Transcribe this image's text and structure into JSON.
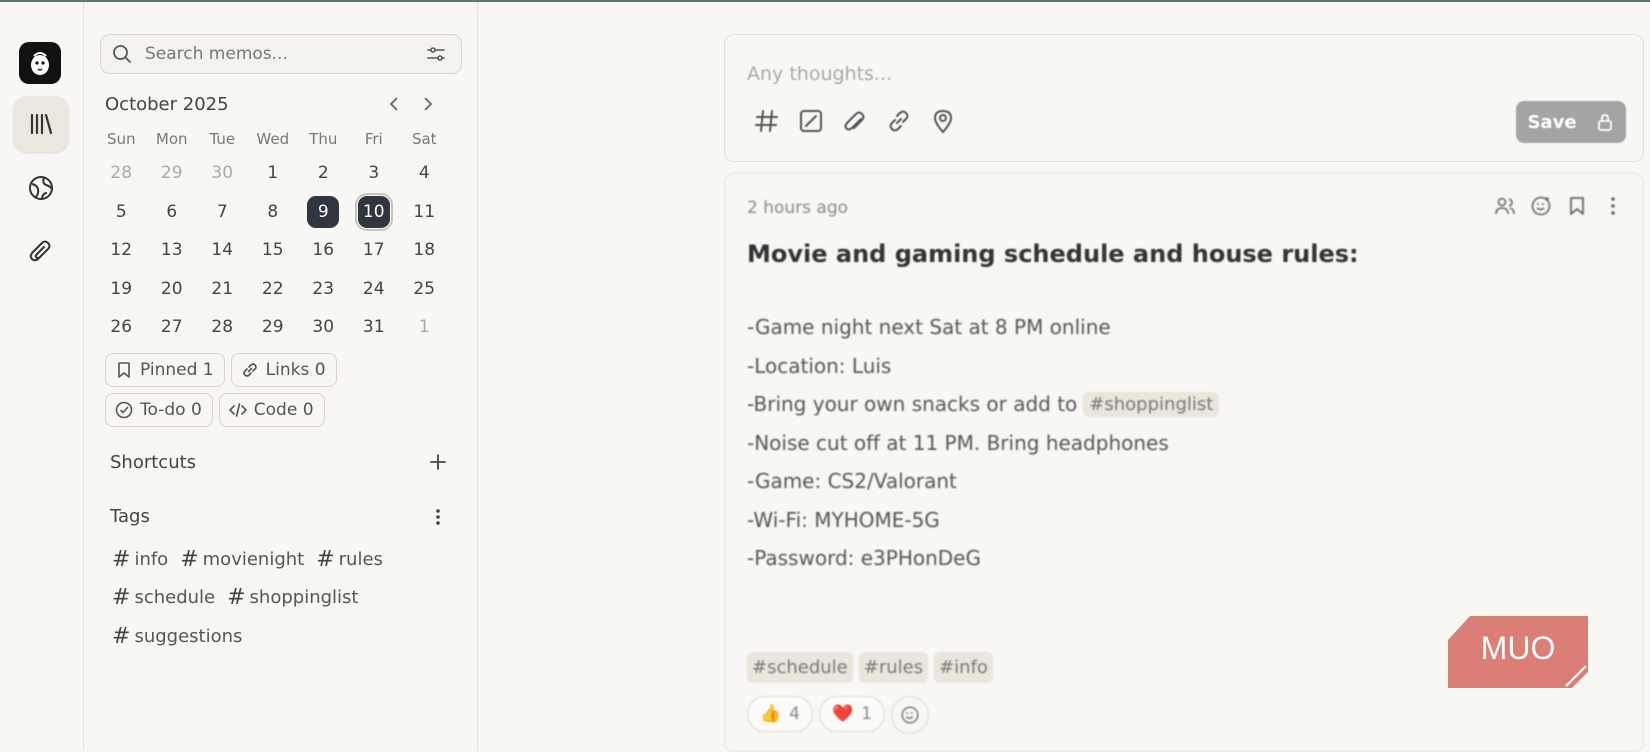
{
  "search": {
    "placeholder": "Search memos..."
  },
  "calendar": {
    "month_label": "October 2025",
    "weekdays": [
      "Sun",
      "Mon",
      "Tue",
      "Wed",
      "Thu",
      "Fri",
      "Sat"
    ],
    "weeks": [
      [
        "28",
        "29",
        "30",
        "1",
        "2",
        "3",
        "4"
      ],
      [
        "5",
        "6",
        "7",
        "8",
        "9",
        "10",
        "11"
      ],
      [
        "12",
        "13",
        "14",
        "15",
        "16",
        "17",
        "18"
      ],
      [
        "19",
        "20",
        "21",
        "22",
        "23",
        "24",
        "25"
      ],
      [
        "26",
        "27",
        "28",
        "29",
        "30",
        "31",
        "1"
      ]
    ],
    "selected_day": "9",
    "today": "10"
  },
  "stats": {
    "pinned": "Pinned 1",
    "links": "Links 0",
    "todo": "To-do 0",
    "code": "Code 0"
  },
  "shortcuts": {
    "title": "Shortcuts"
  },
  "tags": {
    "title": "Tags",
    "items": [
      "info",
      "movienight",
      "rules",
      "schedule",
      "shoppinglist",
      "suggestions"
    ]
  },
  "editor": {
    "placeholder": "Any thoughts...",
    "save_label": "Save"
  },
  "memo": {
    "time": "2 hours ago",
    "title": "Movie and gaming schedule and house rules:",
    "lines": [
      "-Game night next Sat at 8 PM online",
      "-Location: Luis",
      "-Bring your own snacks or add to",
      "-Noise cut off at 11 PM. Bring headphones",
      "-Game: CS2/Valorant",
      "-Wi-Fi: MYHOME-5G",
      "-Password: e3PHonDeG"
    ],
    "inline_tag": "#shoppinglist",
    "tags": [
      "#schedule",
      "#rules",
      "#info"
    ],
    "reactions": [
      {
        "emoji": "👍",
        "count": "4"
      },
      {
        "emoji": "❤️",
        "count": "1"
      }
    ]
  },
  "watermark": {
    "text": "MUO",
    "color": "#d9534f"
  }
}
